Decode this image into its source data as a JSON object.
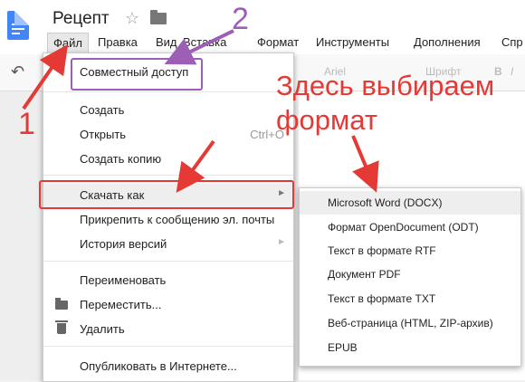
{
  "app": {
    "doc_title": "Рецепт"
  },
  "menubar": [
    "Файл",
    "Правка",
    "Вид",
    "Вставка",
    "Формат",
    "Инструменты",
    "Дополнения",
    "Спр"
  ],
  "toolbar": {
    "font_faint": "Ariel",
    "zoom_faint": "Шрифт",
    "bold_faint": "B",
    "italic_faint": "I"
  },
  "file_menu": {
    "share": "Совместный доступ",
    "create": "Создать",
    "open": "Открыть",
    "open_shortcut": "Ctrl+O",
    "copy": "Создать копию",
    "download_as": "Скачать как",
    "attach": "Прикрепить к сообщению эл. почты",
    "history": "История версий",
    "rename": "Переименовать",
    "move": "Переместить...",
    "delete": "Удалить",
    "publish": "Опубликовать в Интернете..."
  },
  "download_submenu": [
    "Microsoft Word (DOCX)",
    "Формат OpenDocument (ODT)",
    "Текст в формате RTF",
    "Документ PDF",
    "Текст в формате TXT",
    "Веб-страница (HTML, ZIP-архив)",
    "EPUB"
  ],
  "annotations": {
    "num1": "1",
    "num2": "2",
    "note_line1": "Здесь выбираем",
    "note_line2": "формат",
    "red": "#e53935",
    "purple": "#9c5fb5"
  }
}
